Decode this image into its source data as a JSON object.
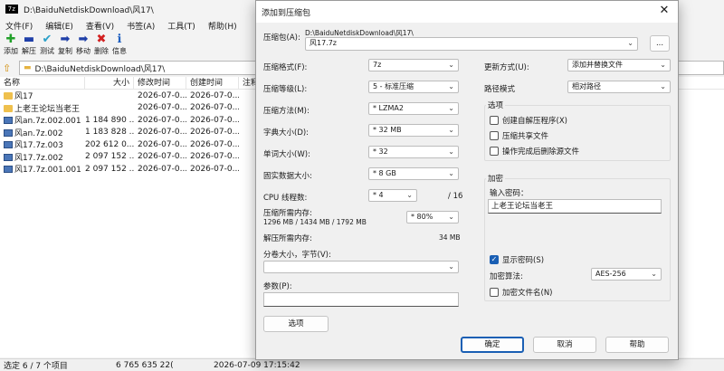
{
  "main_window": {
    "app_icon": "7z",
    "title": "D:\\BaiduNetdiskDownload\\风17\\",
    "menu": [
      "文件(F)",
      "编辑(E)",
      "查看(V)",
      "书签(A)",
      "工具(T)",
      "帮助(H)"
    ],
    "toolbar": [
      {
        "label": "添加",
        "icon": "plus-icon",
        "glyph": "✚",
        "color": "#22a02a"
      },
      {
        "label": "解压",
        "icon": "minus-icon",
        "glyph": "▬",
        "color": "#1f3fa8"
      },
      {
        "label": "测试",
        "icon": "check-icon",
        "glyph": "✔",
        "color": "#2aa0c8"
      },
      {
        "label": "复制",
        "icon": "arrow-right-icon",
        "glyph": "➡",
        "color": "#1f3fa8"
      },
      {
        "label": "移动",
        "icon": "arrow-move-icon",
        "glyph": "➡",
        "color": "#1f3fa8"
      },
      {
        "label": "删除",
        "icon": "delete-x-icon",
        "glyph": "✖",
        "color": "#d22020"
      },
      {
        "label": "信息",
        "icon": "info-icon",
        "glyph": "ℹ",
        "color": "#2060c0"
      }
    ],
    "address": "D:\\BaiduNetdiskDownload\\风17\\",
    "columns": [
      "名称",
      "大小",
      "修改时间",
      "创建时间",
      "注释"
    ],
    "files": [
      {
        "name": "风17",
        "type": "folder",
        "size": "",
        "modified": "2026-07-0...",
        "created": "2026-07-0..."
      },
      {
        "name": "上老王论坛当老王",
        "type": "folder",
        "size": "",
        "modified": "2026-07-0...",
        "created": "2026-07-0..."
      },
      {
        "name": "风an.7z.002.001",
        "type": "file",
        "size": "1 184 890 ...",
        "modified": "2026-07-0...",
        "created": "2026-07-0..."
      },
      {
        "name": "风an.7z.002",
        "type": "file",
        "size": "1 183 828 ...",
        "modified": "2026-07-0...",
        "created": "2026-07-0..."
      },
      {
        "name": "风17.7z.003",
        "type": "file",
        "size": "202 612 0...",
        "modified": "2026-07-0...",
        "created": "2026-07-0..."
      },
      {
        "name": "风17.7z.002",
        "type": "file",
        "size": "2 097 152 ...",
        "modified": "2026-07-0...",
        "created": "2026-07-0..."
      },
      {
        "name": "风17.7z.001.001",
        "type": "file",
        "size": "2 097 152 ...",
        "modified": "2026-07-0...",
        "created": "2026-07-0..."
      }
    ],
    "status": {
      "selected": "选定 6 / 7 个项目",
      "size": "6 765 635 22(",
      "datetime": "2026-07-09 17:15:42"
    }
  },
  "dialog": {
    "title": "添加到压缩包",
    "archive_label": "压缩包(A):",
    "archive_path": "D:\\BaiduNetdiskDownload\\风17\\",
    "archive_name": "风17.7z",
    "browse_label": "...",
    "format_label": "压缩格式(F):",
    "format_value": "7z",
    "level_label": "压缩等级(L):",
    "level_value": "5 - 标准压缩",
    "method_label": "压缩方法(M):",
    "method_value": "* LZMA2",
    "dict_label": "字典大小(D):",
    "dict_value": "* 32 MB",
    "word_label": "单词大小(W):",
    "word_value": "* 32",
    "solid_label": "固实数据大小:",
    "solid_value": "* 8 GB",
    "threads_label": "CPU 线程数:",
    "threads_value": "* 4",
    "threads_total": "/ 16",
    "mem_comp_label": "压缩所需内存:",
    "mem_comp_detail": "1296 MB / 1434 MB / 1792 MB",
    "mem_comp_value": "* 80%",
    "mem_decomp_label": "解压所需内存:",
    "mem_decomp_value": "34 MB",
    "split_label": "分卷大小，字节(V):",
    "split_value": "",
    "params_label": "参数(P):",
    "params_value": "",
    "options_button": "选项",
    "update_label": "更新方式(U):",
    "update_value": "添加并替换文件",
    "path_label": "路径模式",
    "path_value": "相对路径",
    "options_group": "选项",
    "opt_sfx": "创建自解压程序(X)",
    "opt_shared": "压缩共享文件",
    "opt_delete": "操作完成后删除源文件",
    "enc_group": "加密",
    "password_label": "输入密码：",
    "password_value": "上老王论坛当老王",
    "show_password": "显示密码(S)",
    "enc_method_label": "加密算法:",
    "enc_method_value": "AES-256",
    "encrypt_names": "加密文件名(N)",
    "ok": "确定",
    "cancel": "取消",
    "help": "帮助"
  }
}
